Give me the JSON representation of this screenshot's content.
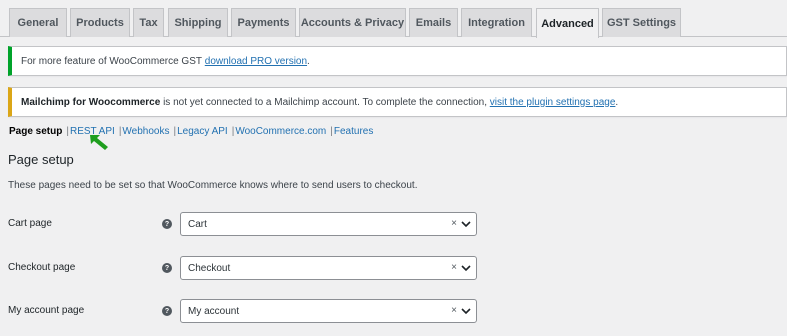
{
  "tabs": [
    {
      "label": "General",
      "active": false
    },
    {
      "label": "Products",
      "active": false
    },
    {
      "label": "Tax",
      "active": false
    },
    {
      "label": "Shipping",
      "active": false
    },
    {
      "label": "Payments",
      "active": false
    },
    {
      "label": "Accounts & Privacy",
      "active": false
    },
    {
      "label": "Emails",
      "active": false
    },
    {
      "label": "Integration",
      "active": false
    },
    {
      "label": "Advanced",
      "active": true
    },
    {
      "label": "GST Settings",
      "active": false
    }
  ],
  "notice_gst": {
    "text": "For more feature of WooCommerce GST ",
    "link": "download PRO version",
    "suffix": "."
  },
  "notice_mailchimp": {
    "bold": "Mailchimp for Woocommerce",
    "text": " is not yet connected to a Mailchimp account. To complete the connection, ",
    "link": "visit the plugin settings page",
    "suffix": "."
  },
  "subnav": {
    "current": "Page setup",
    "sep": "|",
    "links": [
      "REST API",
      "Webhooks",
      "Legacy API",
      "WooCommerce.com",
      "Features"
    ]
  },
  "section": {
    "title": "Page setup",
    "description": "These pages need to be set so that WooCommerce knows where to send users to checkout."
  },
  "fields": [
    {
      "label": "Cart page",
      "value": "Cart"
    },
    {
      "label": "Checkout page",
      "value": "Checkout"
    },
    {
      "label": "My account page",
      "value": "My account"
    }
  ],
  "glyphs": {
    "help": "?",
    "clear": "×"
  },
  "colors": {
    "accent": "#2271b1",
    "success": "#00a32a",
    "warning": "#dba617",
    "arrow": "#1e9e1e"
  },
  "icons": {
    "help": "question-circle-icon",
    "clear": "clear-x-icon",
    "dropdown": "chevron-down-icon",
    "pointer": "arrow-pointer-icon"
  }
}
